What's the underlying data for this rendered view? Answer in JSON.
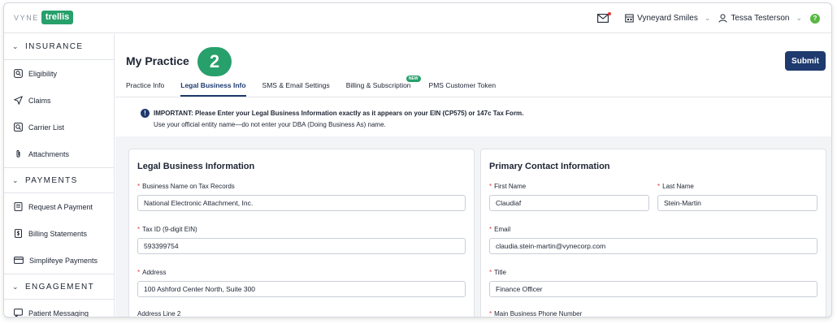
{
  "header": {
    "logo_prefix": "VYNE",
    "logo_brand": "trellis",
    "practice_name": "Vyneyard Smiles",
    "user_name": "Tessa Testerson",
    "help_label": "?"
  },
  "sidebar": {
    "sections": [
      {
        "title": "INSURANCE",
        "items": [
          "Eligibility",
          "Claims",
          "Carrier List",
          "Attachments"
        ]
      },
      {
        "title": "PAYMENTS",
        "items": [
          "Request A Payment",
          "Billing Statements",
          "Simplifeye Payments"
        ]
      },
      {
        "title": "ENGAGEMENT",
        "items": [
          "Patient Messaging"
        ]
      }
    ]
  },
  "main": {
    "title": "My Practice",
    "step_badge": "2",
    "submit_label": "Submit",
    "tabs": [
      {
        "label": "Practice Info"
      },
      {
        "label": "Legal Business Info"
      },
      {
        "label": "SMS & Email Settings"
      },
      {
        "label": "Billing & Subscription",
        "pill": "NEW"
      },
      {
        "label": "PMS Customer Token"
      }
    ],
    "notice": {
      "icon": "!",
      "line1": "IMPORTANT: Please Enter your Legal Business Information exactly as it appears on your EIN (CP575) or 147c Tax Form.",
      "line2": "Use your official entity name—do not enter your DBA (Doing Business As) name."
    }
  },
  "legal_card": {
    "title": "Legal Business Information",
    "business_name_label": "Business Name on Tax Records",
    "business_name_value": "National Electronic Attachment, Inc.",
    "tax_id_label": "Tax ID (9-digit EIN)",
    "tax_id_value": "593399754",
    "address_label": "Address",
    "address_value": "100 Ashford Center North, Suite 300",
    "address2_label": "Address Line 2"
  },
  "contact_card": {
    "title": "Primary Contact Information",
    "first_name_label": "First Name",
    "first_name_value": "Claudiaf",
    "last_name_label": "Last Name",
    "last_name_value": "Stein-Martin",
    "email_label": "Email",
    "email_value": "claudia.stein-martin@vynecorp.com",
    "title_label": "Title",
    "title_value": "Finance Officer",
    "phone_label": "Main Business Phone Number"
  },
  "required_marker": "*",
  "colors": {
    "brand_green": "#27a06b",
    "primary_navy": "#1e3a6e",
    "required_red": "#e23b3b"
  }
}
